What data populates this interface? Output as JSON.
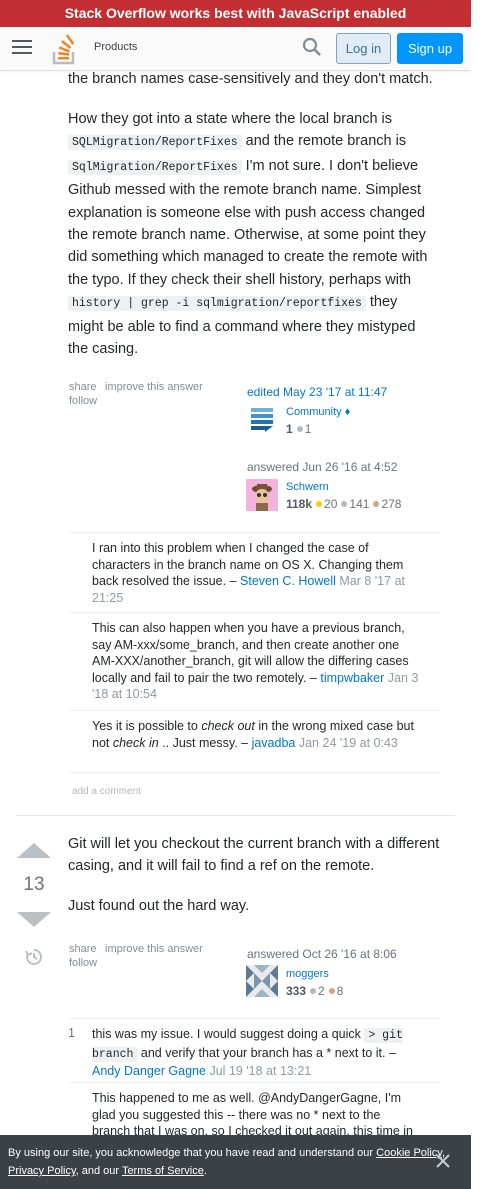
{
  "banner": {
    "text": "Stack Overflow works best with JavaScript enabled"
  },
  "header": {
    "products": "Products",
    "login": "Log in",
    "signup": "Sign up"
  },
  "answer1": {
    "para_top": "the branch names case-sensitively and they don't match.",
    "para2_l1a": "How they got into a state where the local branch is",
    "para2_code1": "SQLMigration/ReportFixes",
    "para2_l2a": "and the remote branch is",
    "para2_code2": "SqlMigration/ReportFixes",
    "para2_l3a": "I'm not sure. I don't believe",
    "para2_l4": "Github messed with the remote branch name. Simplest",
    "para2_l5": "explanation is someone else with push access changed",
    "para2_l6": "the remote branch name. Otherwise, at some point they",
    "para2_l7": "did something which managed to create the remote with",
    "para2_l8": "the typo. If they check their shell history, perhaps with",
    "para2_code3": "history | grep -i sqlmigration/reportfixes",
    "para2_l9a": "they",
    "para2_l10": "might be able to find a command where they mistyped",
    "para2_l11": "the casing.",
    "menu": {
      "share": "share",
      "improve": "improve this answer",
      "follow": "follow"
    },
    "edited": {
      "label": "edited",
      "date": "May 23 '17 at 11:47",
      "user": "Community",
      "diamond": "♦",
      "rep": "1",
      "silver": "1"
    },
    "answered": {
      "label": "answered Jun 26 '16 at 4:52",
      "user": "Schwern",
      "rep": "118k",
      "gold": "20",
      "silver": "141",
      "bronze": "278"
    },
    "comments": [
      {
        "text": "I ran into this problem when I changed the case of characters in the branch name on OS X. Changing them back resolved the issue.",
        "user": "Steven C. Howell",
        "date": "Mar 8 '17 at 21:25"
      },
      {
        "text": "This can also happen when you have a previous branch, say AM-xxx/some_branch, and then create another one AM-XXX/another_branch, git will allow the differing cases locally and fail to pair the two remotely.",
        "user": "timpwbaker",
        "date": "Jan 3 '18 at 10:54"
      },
      {
        "text_pre": "Yes it is possible to ",
        "text_em1": "check out",
        "text_mid": " in the wrong mixed case but not ",
        "text_em2": "check in",
        "text_post": " .. Just messy.",
        "user": "javadba",
        "date": "Jan 24 '19 at 0:43"
      }
    ],
    "add_comment": "add a comment"
  },
  "answer2": {
    "votes": "13",
    "para1": "Git will let you checkout the current branch with a different casing, and it will fail to find a ref on the remote.",
    "para2": "Just found out the hard way.",
    "menu": {
      "share": "share",
      "improve": "improve this answer",
      "follow": "follow"
    },
    "answered": {
      "label": "answered Oct 26 '16 at 8:06",
      "user": "moggers",
      "rep": "333",
      "silver": "2",
      "bronze": "8"
    },
    "comments": [
      {
        "score": "1",
        "text_pre": "this was my issue. I would suggest doing a quick ",
        "code": "> git branch",
        "text_post": " and verify that your branch has a * next to it.",
        "user": "Andy Danger Gagne",
        "date": "Jul 19 '18 at 13:21"
      },
      {
        "text": "This happened to me as well. @AndyDangerGagne, I'm glad you suggested this -- there was no * next to the branch that I was on, so I checked it out again, this time in"
      }
    ]
  },
  "cookie": {
    "text_pre": "By using our site, you acknowledge that you have read and understand our ",
    "cookie_policy": "Cookie Policy",
    "sep1": ", ",
    "privacy_policy": "Privacy Policy",
    "sep2": ", and our ",
    "tos": "Terms of Service",
    "end": "."
  },
  "colors": {
    "banner": "#c22e32",
    "link": "#0077cc",
    "signup": "#0095ff",
    "cookie_bg": "#3c4146"
  },
  "icons": [
    "hamburger-icon",
    "stack-overflow-logo",
    "search-icon",
    "history-icon",
    "close-icon"
  ]
}
